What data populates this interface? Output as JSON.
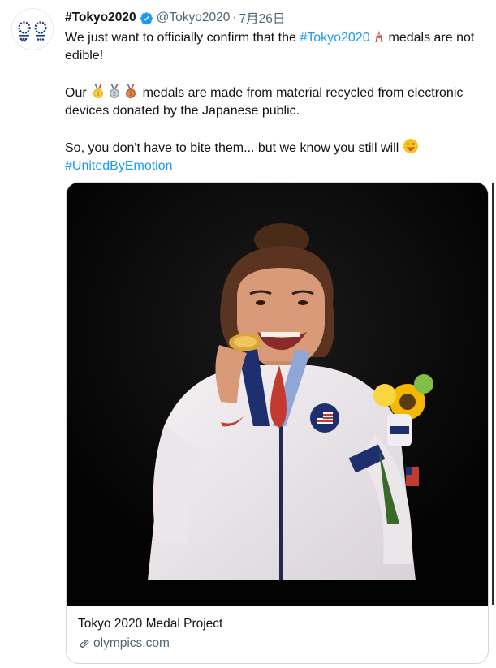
{
  "tweet": {
    "display_name": "#Tokyo2020",
    "handle": "@Tokyo2020",
    "separator": "·",
    "date": "7月26日",
    "line1_before": "We just want to officially confirm that the ",
    "hashtag_tokyo": "#Tokyo2020",
    "line1_after": " medals are not edible!",
    "line2_before": "Our ",
    "line2_after": " medals are made from material recycled from electronic devices donated by the Japanese public.",
    "line3": "So, you don't have to bite them... but we know you still will ",
    "hashtag_united": "#UnitedByEmotion"
  },
  "icons": {
    "verified": "verified-badge-icon",
    "tower": "tokyo-tower-emoji",
    "medals": [
      "gold-medal-emoji",
      "silver-medal-emoji",
      "bronze-medal-emoji"
    ],
    "tongue": "face-with-tongue-emoji",
    "link": "link-icon"
  },
  "card": {
    "title": "Tokyo 2020 Medal Project",
    "domain": "olympics.com"
  },
  "colors": {
    "link": "#1d9bf0",
    "muted": "#536471",
    "verified": "#1d9bf0"
  }
}
